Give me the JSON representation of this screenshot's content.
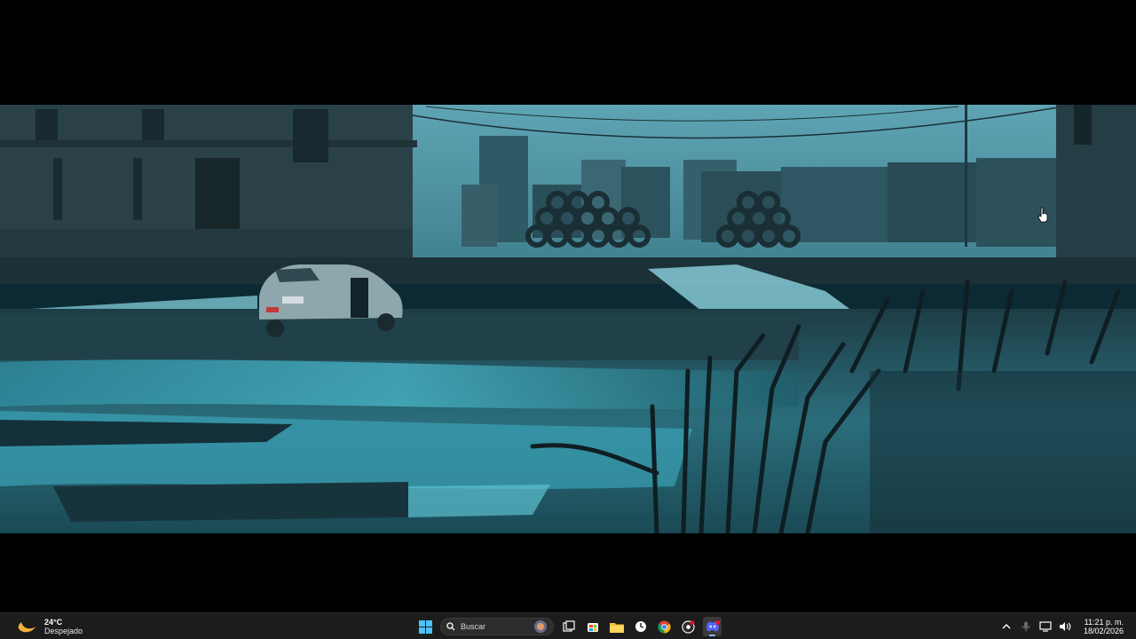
{
  "taskbar": {
    "weather": {
      "temperature": "24°C",
      "description": "Despejado",
      "icon": "moon-icon"
    },
    "search": {
      "placeholder": "Buscar"
    },
    "pinned_apps": [
      {
        "name": "start",
        "icon": "windows-logo-icon"
      },
      {
        "name": "task-view",
        "icon": "task-view-icon"
      },
      {
        "name": "microsoft-store",
        "icon": "store-icon"
      },
      {
        "name": "file-explorer",
        "icon": "folder-icon"
      },
      {
        "name": "clock-app",
        "icon": "clock-icon"
      },
      {
        "name": "chrome",
        "icon": "chrome-icon"
      },
      {
        "name": "obs",
        "icon": "recording-app-icon"
      },
      {
        "name": "discord",
        "icon": "discord-icon",
        "active": true
      }
    ],
    "tray": {
      "icons": [
        "chevron-up-icon",
        "microphone-icon",
        "network-icon",
        "volume-icon"
      ]
    },
    "clock": {
      "time": "11:21 p. m.",
      "date": "18/02/2026"
    }
  },
  "video": {
    "scene": "film-frame",
    "letterbox_color": "#000000"
  },
  "colors": {
    "taskbar_bg": "#1c1c1c",
    "accent": "#8fb8ff"
  }
}
